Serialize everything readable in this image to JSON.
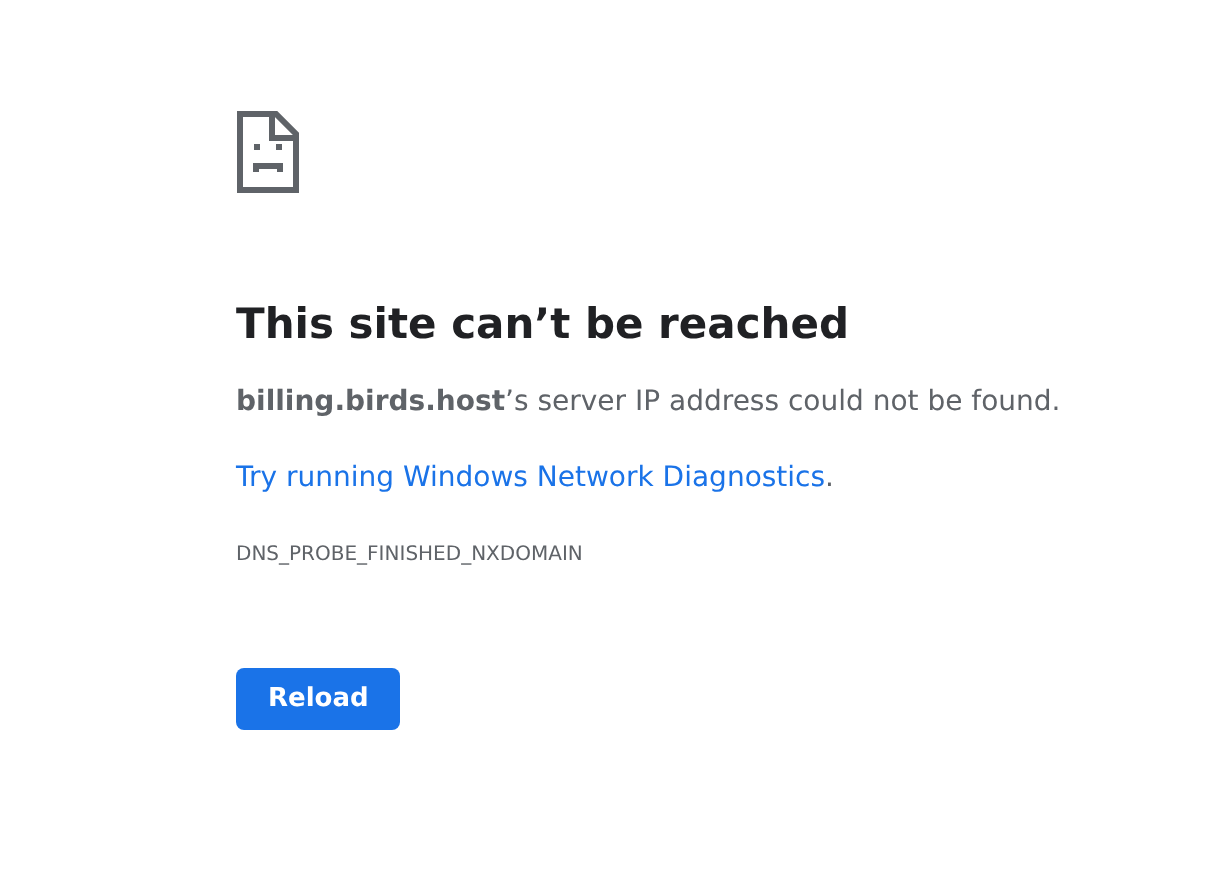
{
  "heading": "This site can’t be reached",
  "message": "**billing.birds.host**’s server IP address could not be found.",
  "suggestion": {
    "link": "Try running Windows Network Diagnostics",
    "after": "."
  },
  "error_code": "DNS_PROBE_FINISHED_NXDOMAIN",
  "buttons": [
    {
      "label": "Reload"
    }
  ]
}
